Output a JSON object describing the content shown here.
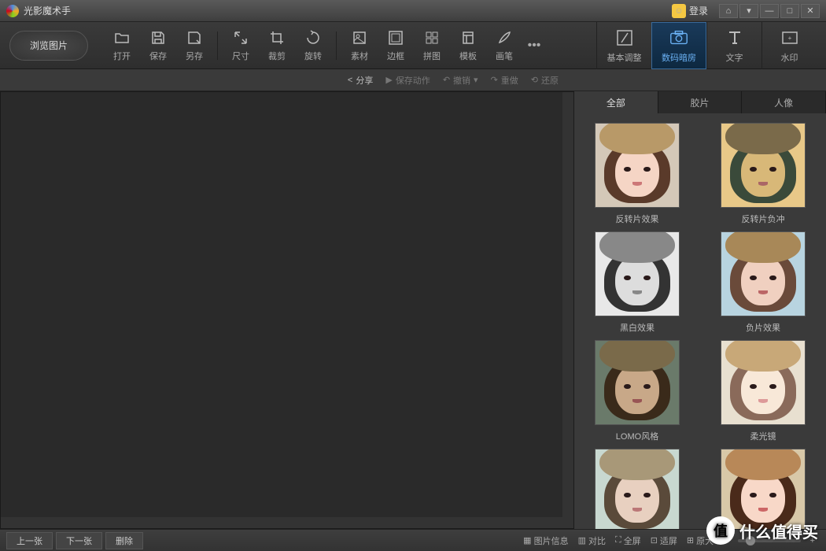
{
  "titlebar": {
    "title": "光影魔术手",
    "login": "登录"
  },
  "toolbar": {
    "browse": "浏览图片",
    "items": [
      {
        "label": "打开"
      },
      {
        "label": "保存"
      },
      {
        "label": "另存"
      },
      {
        "label": "尺寸"
      },
      {
        "label": "裁剪"
      },
      {
        "label": "旋转"
      },
      {
        "label": "素材"
      },
      {
        "label": "边框"
      },
      {
        "label": "拼图"
      },
      {
        "label": "模板"
      },
      {
        "label": "画笔"
      }
    ],
    "right": [
      {
        "label": "基本调整"
      },
      {
        "label": "数码暗房"
      },
      {
        "label": "文字"
      },
      {
        "label": "水印"
      }
    ]
  },
  "subtoolbar": {
    "share": "分享",
    "save_action": "保存动作",
    "undo": "撤销",
    "redo": "重做",
    "restore": "还原"
  },
  "filter_tabs": [
    "全部",
    "胶片",
    "人像"
  ],
  "filters": [
    {
      "label": "反转片效果",
      "style": "normal"
    },
    {
      "label": "反转片负冲",
      "style": "warm"
    },
    {
      "label": "黑白效果",
      "style": "bw"
    },
    {
      "label": "负片效果",
      "style": "neg"
    },
    {
      "label": "LOMO风格",
      "style": "lomo"
    },
    {
      "label": "柔光镜",
      "style": "soft"
    },
    {
      "label": "",
      "style": "cool"
    },
    {
      "label": "",
      "style": "vivid"
    }
  ],
  "bottom": {
    "prev": "上一张",
    "next": "下一张",
    "delete": "删除",
    "info": "图片信息",
    "compare": "对比",
    "fullscreen": "全屏",
    "fit": "适屏",
    "zoom": "原大"
  },
  "watermark": {
    "badge": "值",
    "text": "什么值得买"
  },
  "colors": {
    "normal": {
      "bg": "#d4c8b8",
      "hat": "#b89968",
      "hair": "#5a3a2a",
      "skin": "#f5d5c5",
      "mouth": "#c77"
    },
    "warm": {
      "bg": "#e8c888",
      "hat": "#7a6a4a",
      "hair": "#3a4a3a",
      "skin": "#d8b878",
      "mouth": "#a66"
    },
    "bw": {
      "bg": "#e8e8e8",
      "hat": "#888",
      "hair": "#333",
      "skin": "#ddd",
      "mouth": "#888"
    },
    "neg": {
      "bg": "#b8d4e0",
      "hat": "#a88858",
      "hair": "#6a4a3a",
      "skin": "#f0d0c0",
      "mouth": "#b66"
    },
    "lomo": {
      "bg": "#6a7a6a",
      "hat": "#7a6a4a",
      "hair": "#3a2a1a",
      "skin": "#c8a888",
      "mouth": "#955"
    },
    "soft": {
      "bg": "#e8e0d0",
      "hat": "#c8a878",
      "hair": "#8a6a5a",
      "skin": "#f8e8d8",
      "mouth": "#d99"
    },
    "cool": {
      "bg": "#c8d8d0",
      "hat": "#a89878",
      "hair": "#5a4a3a",
      "skin": "#e8d0c0",
      "mouth": "#b77"
    },
    "vivid": {
      "bg": "#d8c8a8",
      "hat": "#b88858",
      "hair": "#4a2a1a",
      "skin": "#f8d8c8",
      "mouth": "#c66"
    }
  }
}
